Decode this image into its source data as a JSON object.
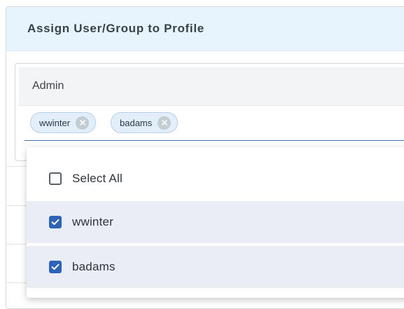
{
  "panel": {
    "title": "Assign User/Group to Profile"
  },
  "profile": {
    "name": "Admin"
  },
  "selected_chips": [
    {
      "label": "wwinter",
      "remove_icon": "close-circle-icon"
    },
    {
      "label": "badams",
      "remove_icon": "close-circle-icon"
    }
  ],
  "dropdown": {
    "select_all": {
      "label": "Select All",
      "checked": false
    },
    "options": [
      {
        "label": "wwinter",
        "checked": true
      },
      {
        "label": "badams",
        "checked": true
      }
    ]
  },
  "colors": {
    "header_bg": "#e7f3fd",
    "accent": "#2f63b8",
    "chip_bg": "#e2eef9",
    "selected_row_bg": "#eaeef4"
  }
}
